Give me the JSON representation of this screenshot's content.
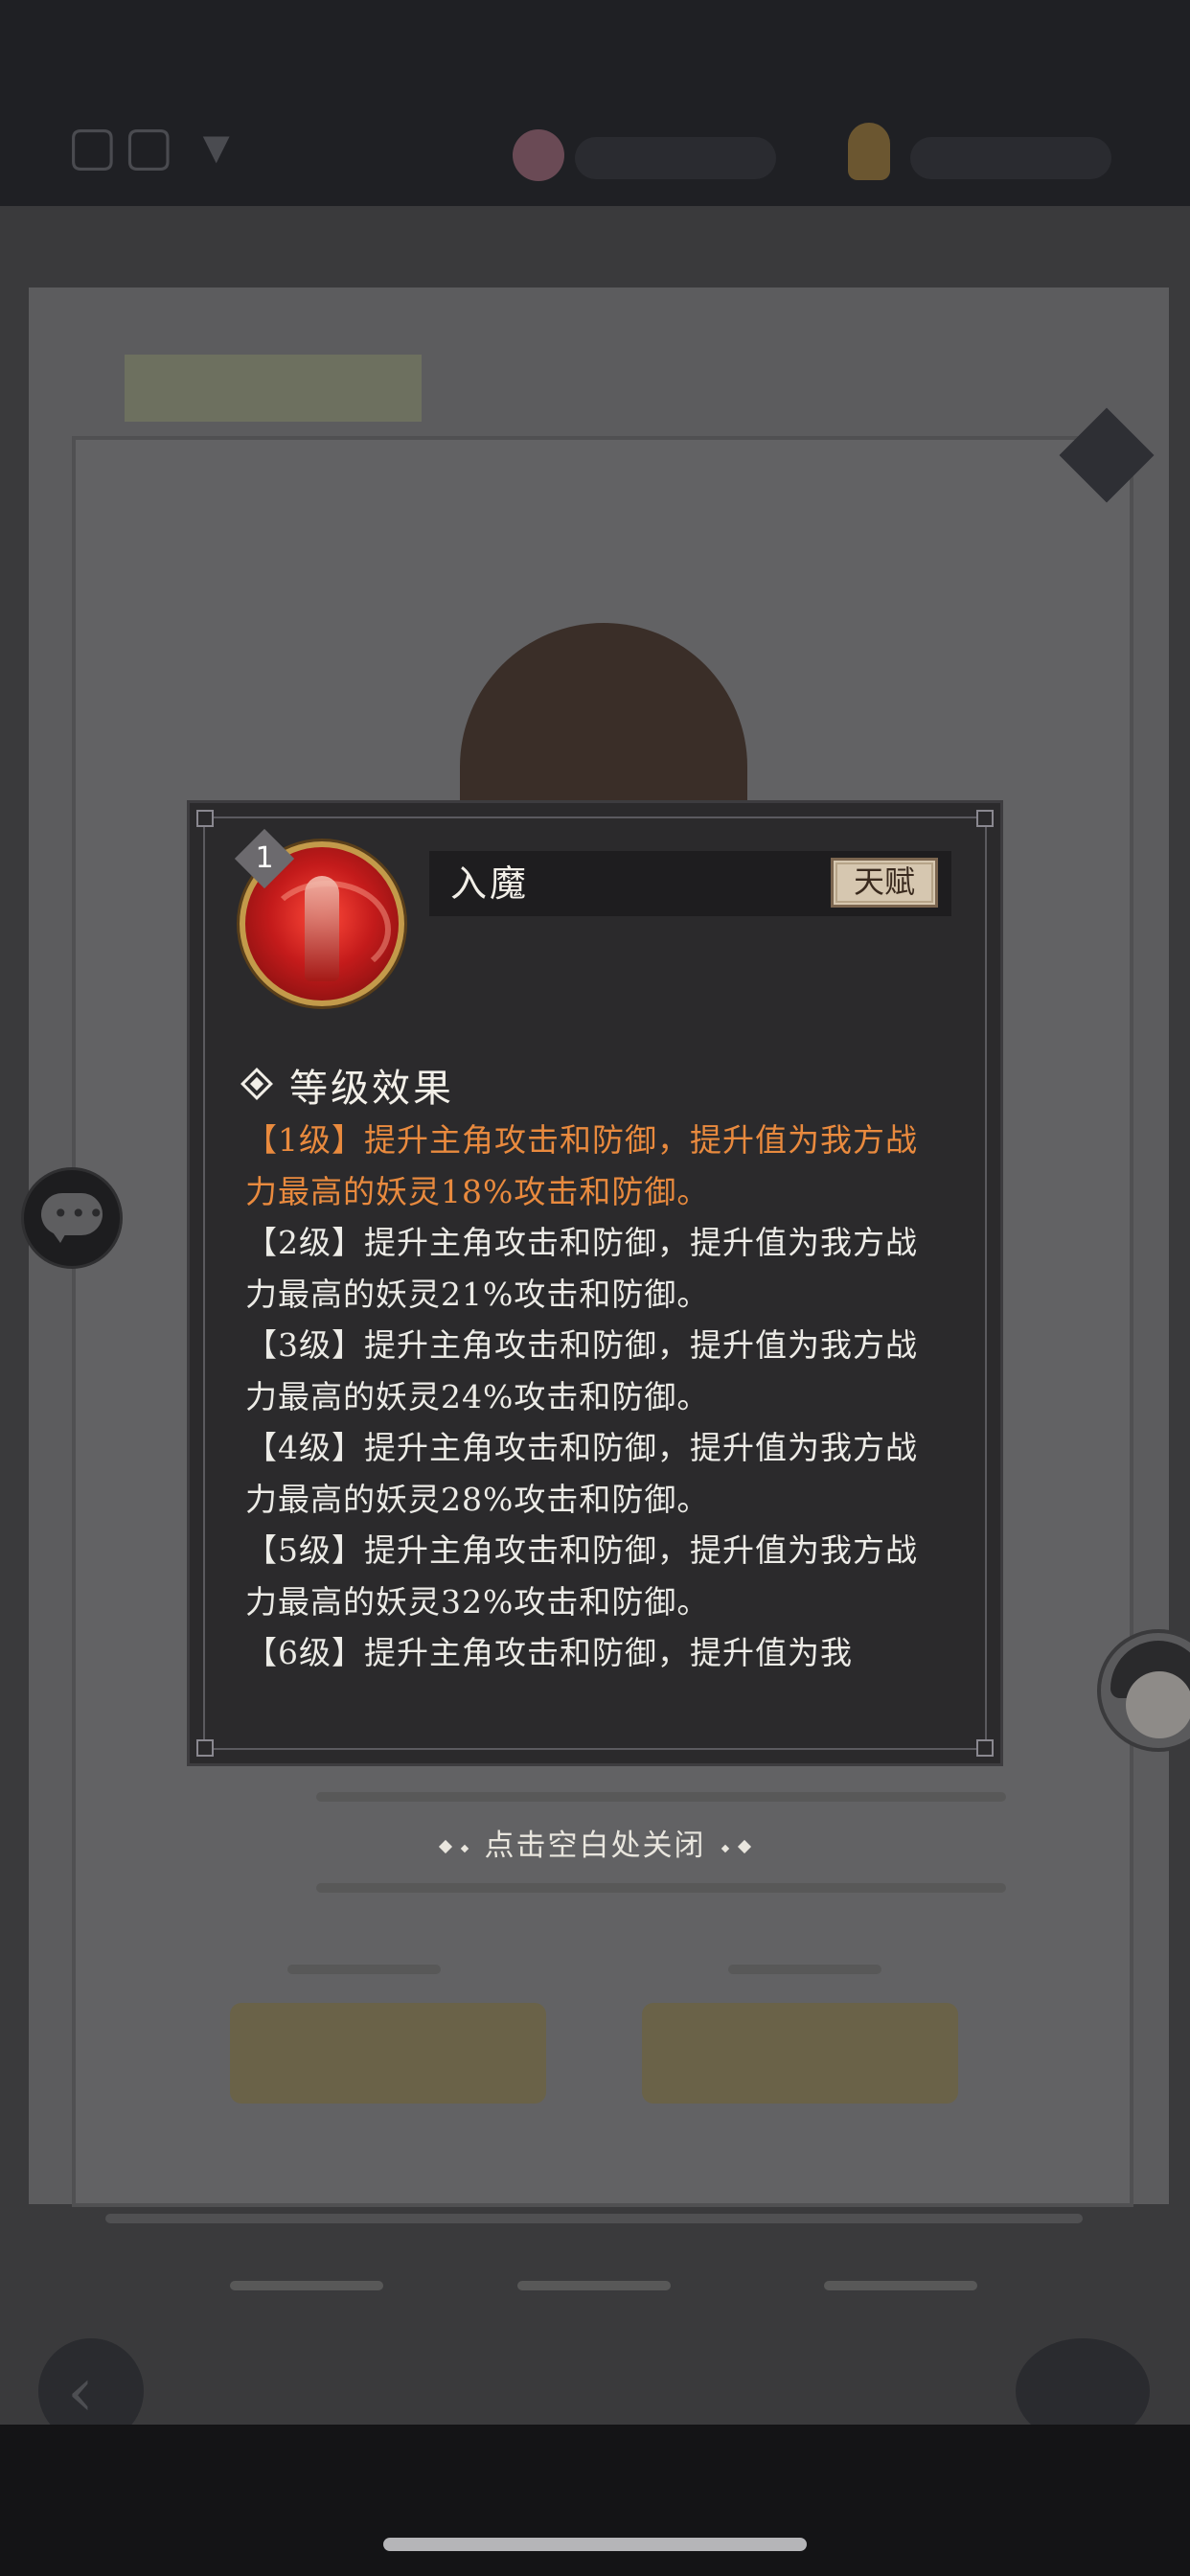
{
  "skill": {
    "level": "1",
    "name": "入魔",
    "tag": "天赋"
  },
  "section_title": "等级效果",
  "effects": [
    {
      "level": "【1级】",
      "text": "提升主角攻击和防御，提升值为我方战力最高的妖灵18%攻击和防御。",
      "active": true
    },
    {
      "level": "【2级】",
      "text": "提升主角攻击和防御，提升值为我方战力最高的妖灵21%攻击和防御。",
      "active": false
    },
    {
      "level": "【3级】",
      "text": "提升主角攻击和防御，提升值为我方战力最高的妖灵24%攻击和防御。",
      "active": false
    },
    {
      "level": "【4级】",
      "text": "提升主角攻击和防御，提升值为我方战力最高的妖灵28%攻击和防御。",
      "active": false
    },
    {
      "level": "【5级】",
      "text": "提升主角攻击和防御，提升值为我方战力最高的妖灵32%攻击和防御。",
      "active": false
    },
    {
      "level": "【6级】",
      "text": "提升主角攻击和防御，提升值为我",
      "active": false
    }
  ],
  "close_hint": "点击空白处关闭",
  "colors": {
    "active_effect": "#e98a3e",
    "text": "#ecebe6",
    "popup_bg": "#2b2a2c",
    "icon_red": "#c41b1b",
    "icon_gold": "#c39a4a"
  },
  "icons": [
    "chat-icon",
    "back-arrow-icon",
    "skill-portrait-icon",
    "diamond-bullet-icon"
  ]
}
